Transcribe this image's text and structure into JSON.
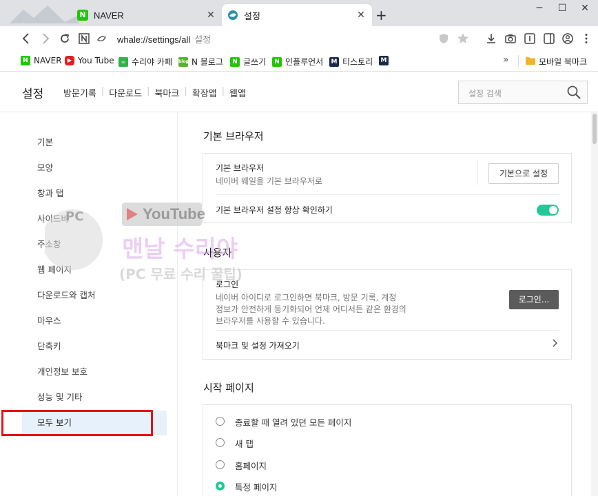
{
  "tabs": [
    {
      "title": "NAVER",
      "favicon_color": "#1ec800",
      "favicon_letter": "N"
    },
    {
      "title": "설정",
      "favicon": "whale-icon"
    }
  ],
  "window": {
    "minimize": "─",
    "maximize": "☐",
    "close": "✕",
    "new_tab": "+"
  },
  "address": {
    "url": "whale://settings/all",
    "page_label": "설정"
  },
  "bookmarks": [
    {
      "label": "NAVER",
      "icon": "N",
      "color": "#1ec800"
    },
    {
      "label": "You Tube",
      "icon": "▶",
      "color": "#e02020"
    },
    {
      "label": "수리야 카페",
      "icon": "☕",
      "color": "#32b24b"
    },
    {
      "label": "N 블로그",
      "icon": "blog",
      "color": "#5ab12a"
    },
    {
      "label": "글쓰기",
      "icon": "N",
      "color": "#1ec800"
    },
    {
      "label": "인플루언서",
      "icon": "N",
      "color": "#1ec800"
    },
    {
      "label": "티스토리",
      "icon": "M",
      "color": "#1b2a48"
    },
    {
      "label": "",
      "icon": "M",
      "color": "#1b2a48"
    }
  ],
  "bookmark_overflow": "»",
  "mobile_bookmarks": "모바일 북마크",
  "header": {
    "title": "설정",
    "nav": [
      "방문기록",
      "다운로드",
      "북마크",
      "확장앱",
      "웹앱"
    ],
    "search_placeholder": "설정 검색"
  },
  "sidebar": {
    "items": [
      "기본",
      "모양",
      "창과 탭",
      "사이드바",
      "주소창",
      "웹 페이지",
      "다운로드와 캡처",
      "마우스",
      "단축키",
      "개인정보 보호",
      "성능 및 기타",
      "모두 보기"
    ],
    "active_index": 11
  },
  "watermark": {
    "badge": "PC",
    "brand": "YouTube",
    "line1": "맨날 수리야",
    "line2": "(PC 무료 수리 꿀팁)"
  },
  "sections": {
    "default_browser": {
      "title": "기본 브라우저",
      "row1_title": "기본 브라우저",
      "row1_desc": "네이버 웨일을 기본 브라우저로",
      "row1_button": "기본으로 설정",
      "row2_title": "기본 브라우저 설정 항상 확인하기",
      "row2_toggle_on": true
    },
    "user": {
      "title": "사용자",
      "login_title": "로그인",
      "login_desc_1": "네이버 아이디로 로그인하면 북마크, 방문 기록, 계정",
      "login_desc_2": "정보가 안전하게 동기화되어 언제 어디서든 같은 환경의",
      "login_desc_3": "브라우저를 사용할 수 있습니다.",
      "login_button": "로그인...",
      "import_label": "북마크 및 설정 가져오기"
    },
    "startup": {
      "title": "시작 페이지",
      "options": [
        "종료할 때 열려 있던 모든 페이지",
        "새 탭",
        "홈페이지",
        "특정 페이지"
      ],
      "selected_index": 3
    }
  },
  "colors": {
    "accent": "#20c997",
    "highlight_box": "#e0141b",
    "active_bg": "#e7f1fb"
  }
}
